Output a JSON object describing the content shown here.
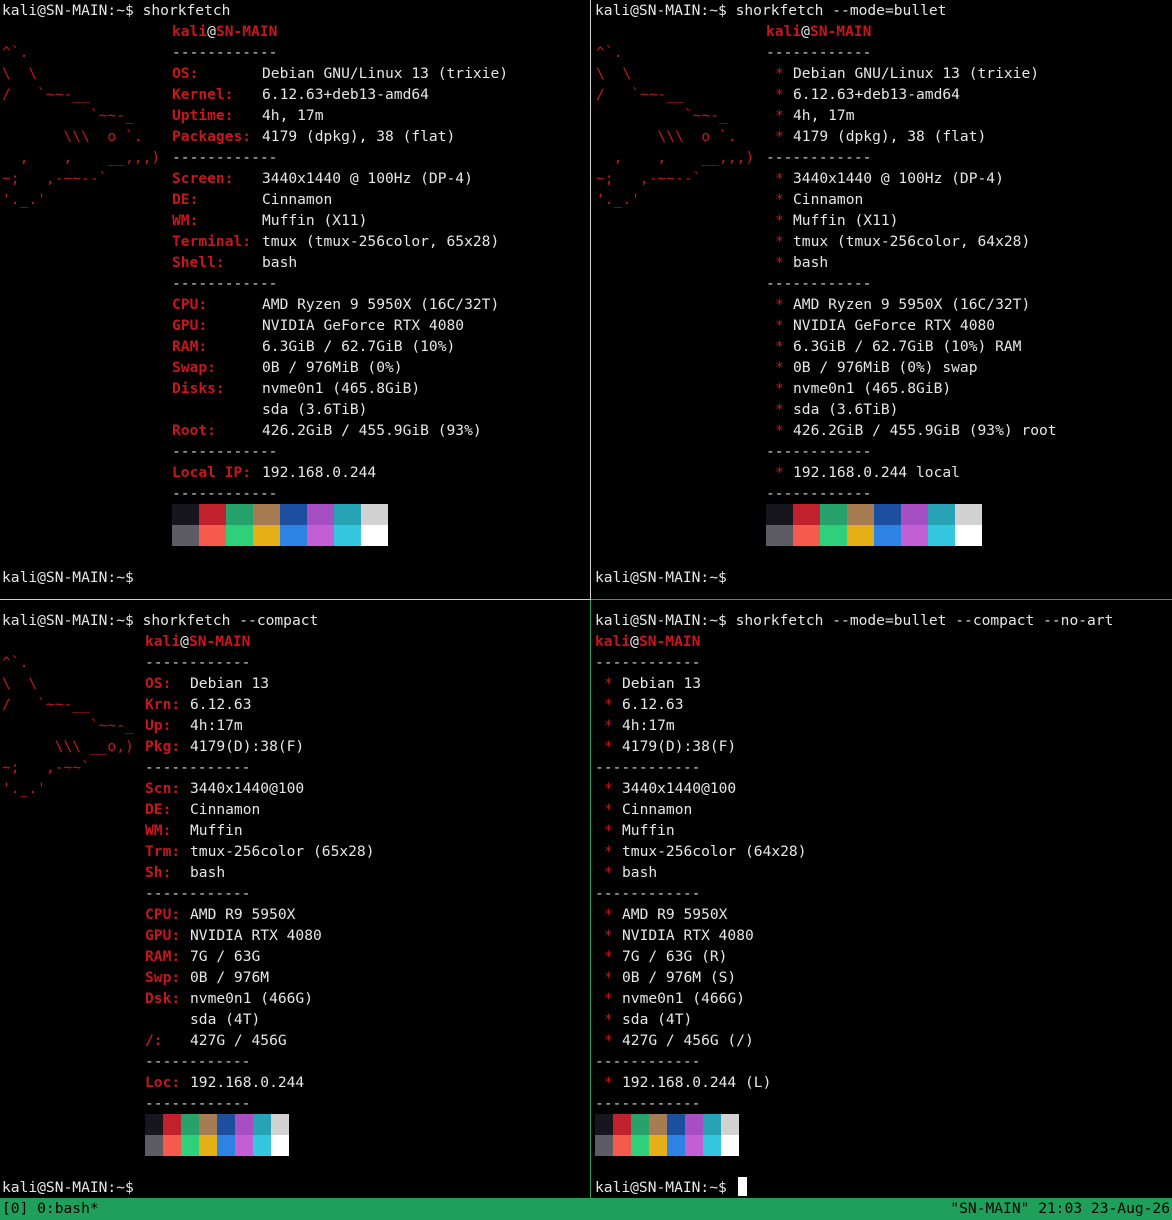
{
  "prompt": "kali@SN-MAIN:~$",
  "colors": {
    "accent_red": "#c8161d",
    "status_bar": "#1fa05a",
    "pane_border_active": "#2aa25a",
    "palette_top": [
      "#17161f",
      "#c1212c",
      "#27a26a",
      "#a67c52",
      "#1c4fa0",
      "#a54fc2",
      "#27a3b5",
      "#d2d2d2"
    ],
    "palette_bottom": [
      "#5d5c65",
      "#f55a4d",
      "#2ed07b",
      "#e6ae17",
      "#2d82e4",
      "#c35fd4",
      "#34c8e0",
      "#ffffff"
    ]
  },
  "panes": [
    {
      "command": "shorkfetch",
      "user": "kali",
      "at": "@",
      "host": "SN-MAIN",
      "separator": "------------",
      "art": "^`.\n\\  \\\n/   `~~-__\n          `~~-_\n       \\\\\\  o `.\n  ,    ,    __,,,)\n~;   ,-~~--`\n'._.'",
      "rows": [
        {
          "label": "OS:",
          "value": "Debian GNU/Linux 13 (trixie)"
        },
        {
          "label": "Kernel:",
          "value": "6.12.63+deb13-amd64"
        },
        {
          "label": "Uptime:",
          "value": "4h, 17m"
        },
        {
          "label": "Packages:",
          "value": "4179 (dpkg), 38 (flat)"
        },
        {
          "sep": true
        },
        {
          "label": "Screen:",
          "value": "3440x1440 @ 100Hz (DP-4)"
        },
        {
          "label": "DE:",
          "value": "Cinnamon"
        },
        {
          "label": "WM:",
          "value": "Muffin (X11)"
        },
        {
          "label": "Terminal:",
          "value": "tmux (tmux-256color, 65x28)"
        },
        {
          "label": "Shell:",
          "value": "bash"
        },
        {
          "sep": true
        },
        {
          "label": "CPU:",
          "value": "AMD Ryzen 9 5950X (16C/32T)"
        },
        {
          "label": "GPU:",
          "value": "NVIDIA GeForce RTX 4080"
        },
        {
          "label": "RAM:",
          "value": "6.3GiB / 62.7GiB (10%)"
        },
        {
          "label": "Swap:",
          "value": "0B / 976MiB (0%)"
        },
        {
          "label": "Disks:",
          "value": "nvme0n1 (465.8GiB)"
        },
        {
          "label": "",
          "value": "sda (3.6TiB)"
        },
        {
          "label": "Root:",
          "value": "426.2GiB / 455.9GiB (93%)"
        },
        {
          "sep": true
        },
        {
          "label": "Local IP:",
          "value": "192.168.0.244"
        },
        {
          "sep": true
        }
      ]
    },
    {
      "command": "shorkfetch --mode=bullet",
      "user": "kali",
      "at": "@",
      "host": "SN-MAIN",
      "separator": "------------",
      "bullet": "*",
      "art": "^`.\n\\  \\\n/   `~~-__\n          `~~-_\n       \\\\\\  o `.\n  ,    ,    __,,,)\n~;   ,-~~--`\n'._.'",
      "rows": [
        {
          "value": "Debian GNU/Linux 13 (trixie)"
        },
        {
          "value": "6.12.63+deb13-amd64"
        },
        {
          "value": "4h, 17m"
        },
        {
          "value": "4179 (dpkg), 38 (flat)"
        },
        {
          "sep": true
        },
        {
          "value": "3440x1440 @ 100Hz (DP-4)"
        },
        {
          "value": "Cinnamon"
        },
        {
          "value": "Muffin (X11)"
        },
        {
          "value": "tmux (tmux-256color, 64x28)"
        },
        {
          "value": "bash"
        },
        {
          "sep": true
        },
        {
          "value": "AMD Ryzen 9 5950X (16C/32T)"
        },
        {
          "value": "NVIDIA GeForce RTX 4080"
        },
        {
          "value": "6.3GiB / 62.7GiB (10%) RAM"
        },
        {
          "value": "0B / 976MiB (0%) swap"
        },
        {
          "value": "nvme0n1 (465.8GiB)"
        },
        {
          "value": "sda (3.6TiB)"
        },
        {
          "value": "426.2GiB / 455.9GiB (93%) root"
        },
        {
          "sep": true
        },
        {
          "value": "192.168.0.244 local"
        },
        {
          "sep": true
        }
      ]
    },
    {
      "command": "shorkfetch --compact",
      "user": "kali",
      "at": "@",
      "host": "SN-MAIN",
      "separator": "------------",
      "art": "^`.\n\\  \\\n/   `~~-__\n          `~~-_\n      \\\\\\ __o,)\n~;   ,-~~`\n'._.'",
      "rows": [
        {
          "label": "OS:",
          "value": "Debian 13"
        },
        {
          "label": "Krn:",
          "value": "6.12.63"
        },
        {
          "label": "Up:",
          "value": "4h:17m"
        },
        {
          "label": "Pkg:",
          "value": "4179(D):38(F)"
        },
        {
          "sep": true
        },
        {
          "label": "Scn:",
          "value": "3440x1440@100"
        },
        {
          "label": "DE:",
          "value": "Cinnamon"
        },
        {
          "label": "WM:",
          "value": "Muffin"
        },
        {
          "label": "Trm:",
          "value": "tmux-256color (65x28)"
        },
        {
          "label": "Sh:",
          "value": "bash"
        },
        {
          "sep": true
        },
        {
          "label": "CPU:",
          "value": "AMD R9 5950X"
        },
        {
          "label": "GPU:",
          "value": "NVIDIA RTX 4080"
        },
        {
          "label": "RAM:",
          "value": "7G / 63G"
        },
        {
          "label": "Swp:",
          "value": "0B / 976M"
        },
        {
          "label": "Dsk:",
          "value": "nvme0n1 (466G)"
        },
        {
          "label": "",
          "value": "sda (4T)"
        },
        {
          "label": "/:",
          "value": "427G / 456G"
        },
        {
          "sep": true
        },
        {
          "label": "Loc:",
          "value": "192.168.0.244"
        },
        {
          "sep": true
        }
      ]
    },
    {
      "command": "shorkfetch --mode=bullet --compact --no-art",
      "user": "kali",
      "at": "@",
      "host": "SN-MAIN",
      "separator": "------------",
      "bullet": "*",
      "rows": [
        {
          "value": "Debian 13"
        },
        {
          "value": "6.12.63"
        },
        {
          "value": "4h:17m"
        },
        {
          "value": "4179(D):38(F)"
        },
        {
          "sep": true
        },
        {
          "value": "3440x1440@100"
        },
        {
          "value": "Cinnamon"
        },
        {
          "value": "Muffin"
        },
        {
          "value": "tmux-256color (64x28)"
        },
        {
          "value": "bash"
        },
        {
          "sep": true
        },
        {
          "value": "AMD R9 5950X"
        },
        {
          "value": "NVIDIA RTX 4080"
        },
        {
          "value": "7G / 63G (R)"
        },
        {
          "value": "0B / 976M (S)"
        },
        {
          "value": "nvme0n1 (466G)"
        },
        {
          "value": "sda (4T)"
        },
        {
          "value": "427G / 456G (/)"
        },
        {
          "sep": true
        },
        {
          "value": "192.168.0.244 (L)"
        },
        {
          "sep": true
        }
      ]
    }
  ],
  "status_bar": {
    "left": "[0] 0:bash*",
    "right": "\"SN-MAIN\" 21:03 23-Aug-26"
  }
}
